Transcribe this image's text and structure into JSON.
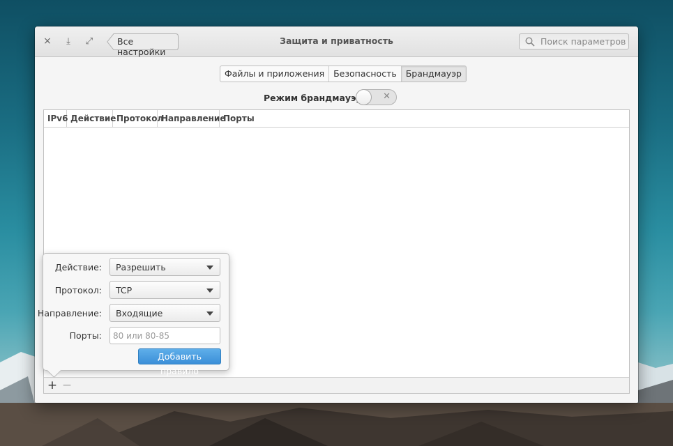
{
  "window": {
    "title": "Защита и приватность",
    "back_label": "Все настройки",
    "close_glyph": "×",
    "minimize_glyph": "⤓",
    "maximize_glyph": "⤢",
    "search_placeholder": "Поиск параметров"
  },
  "tabs": [
    {
      "label": "Файлы и приложения",
      "active": false
    },
    {
      "label": "Безопасность",
      "active": false
    },
    {
      "label": "Брандмауэр",
      "active": true
    }
  ],
  "firewall": {
    "mode_label": "Режим брандмауэр:",
    "enabled": false,
    "off_glyph": "✕"
  },
  "table": {
    "columns": [
      "IPv6",
      "Действие",
      "Протокол",
      "Направление",
      "Порты"
    ],
    "rows": []
  },
  "toolbar": {
    "add_glyph": "+",
    "remove_glyph": "−"
  },
  "rule_form": {
    "action_label": "Действие:",
    "action_value": "Разрешить",
    "protocol_label": "Протокол:",
    "protocol_value": "TCP",
    "direction_label": "Направление:",
    "direction_value": "Входящие",
    "ports_label": "Порты:",
    "ports_placeholder": "80 или 80-85",
    "ports_value": "",
    "add_rule_label": "Добавить правило"
  },
  "colors": {
    "accent": "#3b8fd8",
    "window_bg": "#f5f5f5"
  }
}
